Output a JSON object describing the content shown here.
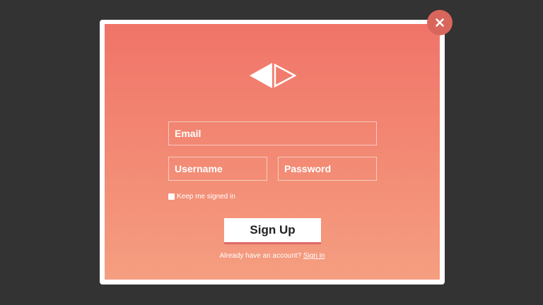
{
  "modal": {
    "close_icon": "close-icon",
    "logo_icon": "triangle-logo-icon",
    "colors": {
      "overlay": "#333333",
      "gradient_top": "#f07468",
      "gradient_bottom": "#f59e80",
      "close_bg": "#d9665c",
      "button_accent": "#e06a66"
    }
  },
  "form": {
    "email_placeholder": "Email",
    "username_placeholder": "Username",
    "password_placeholder": "Password",
    "remember_label": "Keep me signed in",
    "remember_checked": false,
    "submit_label": "Sign Up",
    "signin_prompt": "Already have an account?",
    "signin_link": "Sign in"
  }
}
